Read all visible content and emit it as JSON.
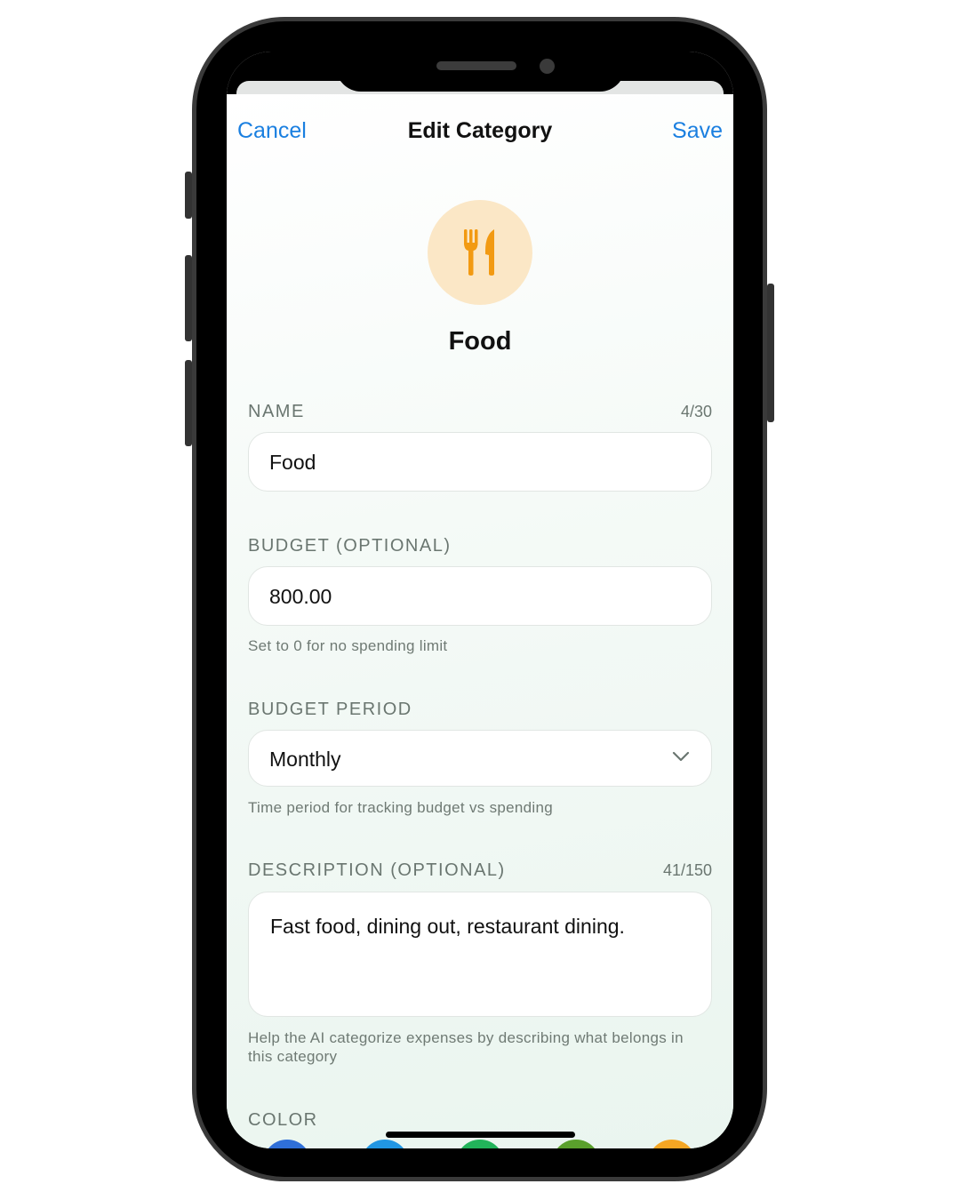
{
  "nav": {
    "cancel_label": "Cancel",
    "title": "Edit Category",
    "save_label": "Save"
  },
  "category": {
    "icon": "fork-knife-icon",
    "name": "Food"
  },
  "fields": {
    "name": {
      "label": "NAME",
      "counter": "4/30",
      "value": "Food"
    },
    "budget": {
      "label": "BUDGET (OPTIONAL)",
      "value": "800.00",
      "helper": "Set to 0 for no spending limit"
    },
    "budget_period": {
      "label": "BUDGET PERIOD",
      "value": "Monthly",
      "helper": "Time period for tracking budget vs spending"
    },
    "description": {
      "label": "DESCRIPTION (OPTIONAL)",
      "counter": "41/150",
      "value": "Fast food, dining out, restaurant dining.",
      "helper": "Help the AI categorize expenses by describing what belongs in this category"
    },
    "color": {
      "label": "COLOR"
    }
  },
  "colors": {
    "accent": "#1a7fe0",
    "icon_orange": "#f29a12",
    "icon_bg": "#fbe7c6",
    "swatches": [
      "#2f6fd8",
      "#2196e3",
      "#22b35a",
      "#5aa02c",
      "#f5a623"
    ]
  }
}
